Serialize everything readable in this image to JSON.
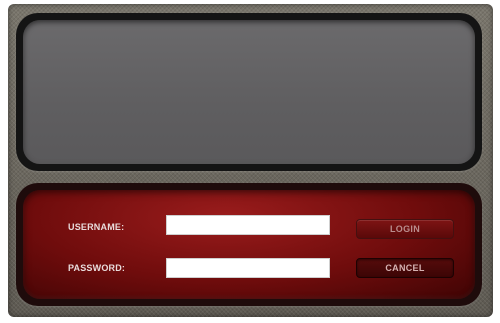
{
  "login_form": {
    "username_label": "USERNAME:",
    "password_label": "PASSWORD:",
    "username_value": "",
    "password_value": "",
    "login_label": "LOGIN",
    "cancel_label": "CANCEL"
  },
  "colors": {
    "frame": "#6e6a61",
    "display_screen": "#656466",
    "panel_red": "#8a1616",
    "input_background": "#ffffff"
  }
}
